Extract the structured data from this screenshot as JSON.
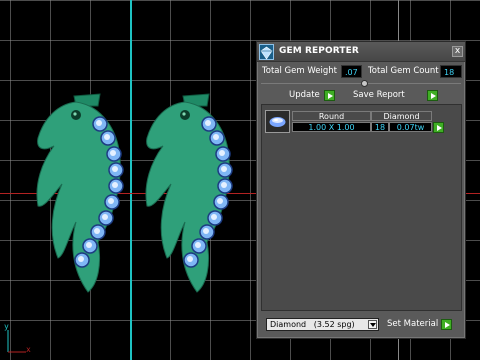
{
  "viewport": {
    "axis_labels": {
      "y": "y",
      "x": "x"
    },
    "colors": {
      "background": "#000000",
      "gem_body": "#2fa07a",
      "stone": "#7fb6f5",
      "axis_cyan": "#1ec3c3",
      "axis_red": "#b32222"
    }
  },
  "panel": {
    "title": "GEM REPORTER",
    "close_label": "x",
    "total_weight_label": "Total Gem Weight",
    "total_weight_value": ".07",
    "total_count_label": "Total Gem Count",
    "total_count_value": "18",
    "update_label": "Update",
    "save_report_label": "Save Report",
    "gems": [
      {
        "shape_header": "Round",
        "size": "1.00 X 1.00",
        "material_header": "Diamond",
        "count": "18",
        "weight": "0.07tw"
      }
    ],
    "material_select": "Diamond   (3.52 spg)",
    "set_material_label": "Set Material",
    "accent_color": "#3fae24",
    "value_color": "#3fd3f5"
  }
}
